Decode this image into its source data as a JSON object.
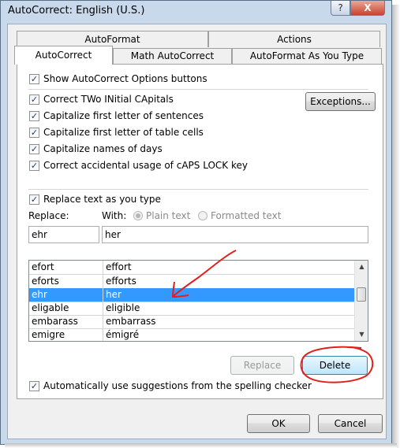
{
  "window": {
    "title": "AutoCorrect: English (U.S.)",
    "help_label": "?",
    "close_label": "X"
  },
  "tabs": {
    "row_back": [
      {
        "label": "AutoFormat"
      },
      {
        "label": "Actions"
      }
    ],
    "row_front": [
      {
        "label": "AutoCorrect",
        "selected": true
      },
      {
        "label": "Math AutoCorrect"
      },
      {
        "label": "AutoFormat As You Type"
      }
    ]
  },
  "options": {
    "show_buttons": {
      "label": "Show AutoCorrect Options buttons",
      "checked": true
    },
    "two_initial": {
      "label": "Correct TWo INitial CApitals",
      "checked": true
    },
    "first_sentence": {
      "label": "Capitalize first letter of sentences",
      "checked": true
    },
    "first_table": {
      "label": "Capitalize first letter of table cells",
      "checked": true
    },
    "names_days": {
      "label": "Capitalize names of days",
      "checked": true
    },
    "caps_lock": {
      "label": "Correct accidental usage of cAPS LOCK key",
      "checked": true
    },
    "exceptions_button": "Exceptions..."
  },
  "replace_section": {
    "replace_as_type": {
      "label": "Replace text as you type",
      "checked": true
    },
    "replace_label": "Replace:",
    "with_label": "With:",
    "plain_text_label": "Plain text",
    "formatted_text_label": "Formatted text",
    "replace_value": "ehr",
    "with_value": "her"
  },
  "entries": [
    {
      "from": "efort",
      "to": "effort"
    },
    {
      "from": "eforts",
      "to": "efforts"
    },
    {
      "from": "ehr",
      "to": "her",
      "selected": true
    },
    {
      "from": "eligable",
      "to": "eligible"
    },
    {
      "from": "embarass",
      "to": "embarrass"
    },
    {
      "from": "emigre",
      "to": "émigré"
    }
  ],
  "buttons": {
    "replace": "Replace",
    "delete": "Delete",
    "ok": "OK",
    "cancel": "Cancel"
  },
  "suggestions": {
    "label": "Automatically use suggestions from the spelling checker",
    "checked": true
  },
  "colors": {
    "selection": "#3399ff",
    "annotation": "#e0201c",
    "frame": "#c9d9ec"
  }
}
